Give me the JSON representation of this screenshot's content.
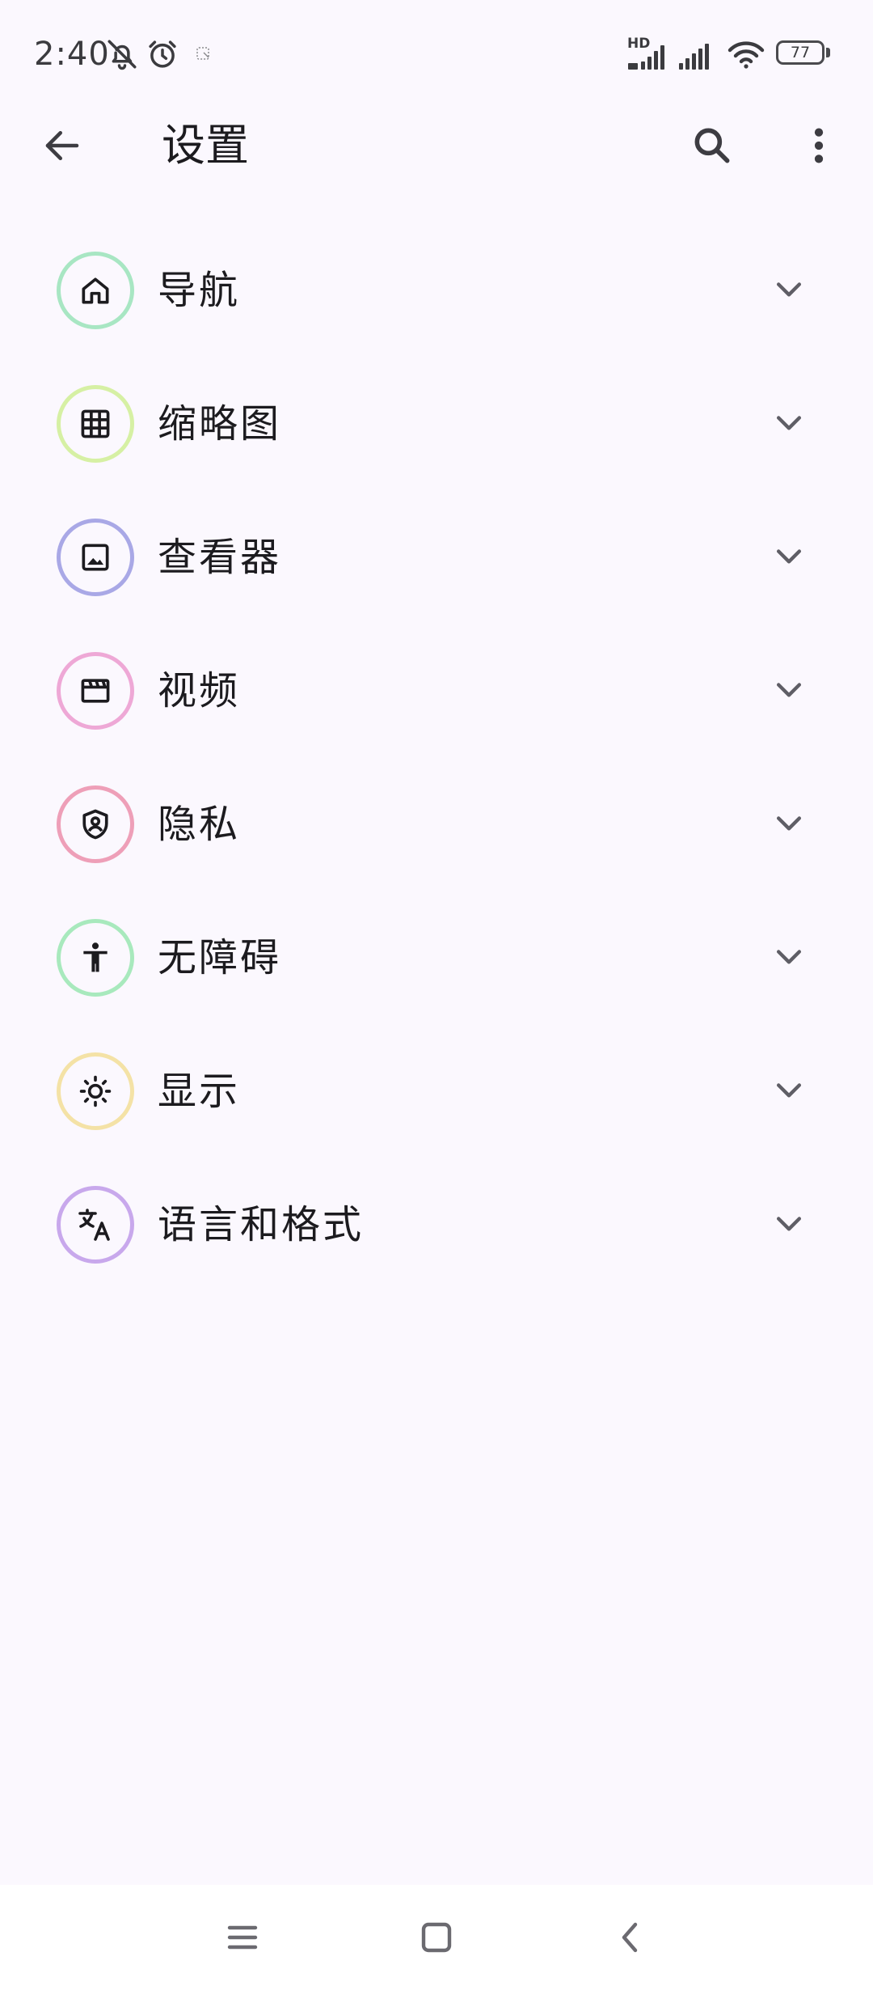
{
  "status_bar": {
    "time": "2:40",
    "battery_level": "77",
    "network_label": "HD",
    "icons": [
      "bell-off-icon",
      "alarm-icon",
      "screenshot-notification-icon",
      "hd-signal-icon",
      "signal-icon",
      "wifi-icon",
      "battery-icon"
    ]
  },
  "app_bar": {
    "title": "设置",
    "back_icon": "arrow-left-icon",
    "search_icon": "search-icon",
    "more_icon": "more-vert-icon"
  },
  "settings": [
    {
      "label": "导航",
      "icon": "home-icon",
      "ring_color": "#a8e6c3"
    },
    {
      "label": "缩略图",
      "icon": "grid-icon",
      "ring_color": "#d6f0a4"
    },
    {
      "label": "查看器",
      "icon": "image-icon",
      "ring_color": "#a9a8e6"
    },
    {
      "label": "视频",
      "icon": "movie-icon",
      "ring_color": "#eea8d6"
    },
    {
      "label": "隐私",
      "icon": "shield-person-icon",
      "ring_color": "#ee9fb8"
    },
    {
      "label": "无障碍",
      "icon": "accessibility-icon",
      "ring_color": "#a8e9bd"
    },
    {
      "label": "显示",
      "icon": "brightness-icon",
      "ring_color": "#f4e2a6"
    },
    {
      "label": "语言和格式",
      "icon": "translate-icon",
      "ring_color": "#c8a8ec"
    }
  ],
  "nav_bar": {
    "icons": [
      "menu-icon",
      "home-square-icon",
      "back-chevron-icon"
    ]
  },
  "colors": {
    "background": "#fbf8fe",
    "text": "#1c1b1f",
    "chevron": "#5f5e66"
  }
}
